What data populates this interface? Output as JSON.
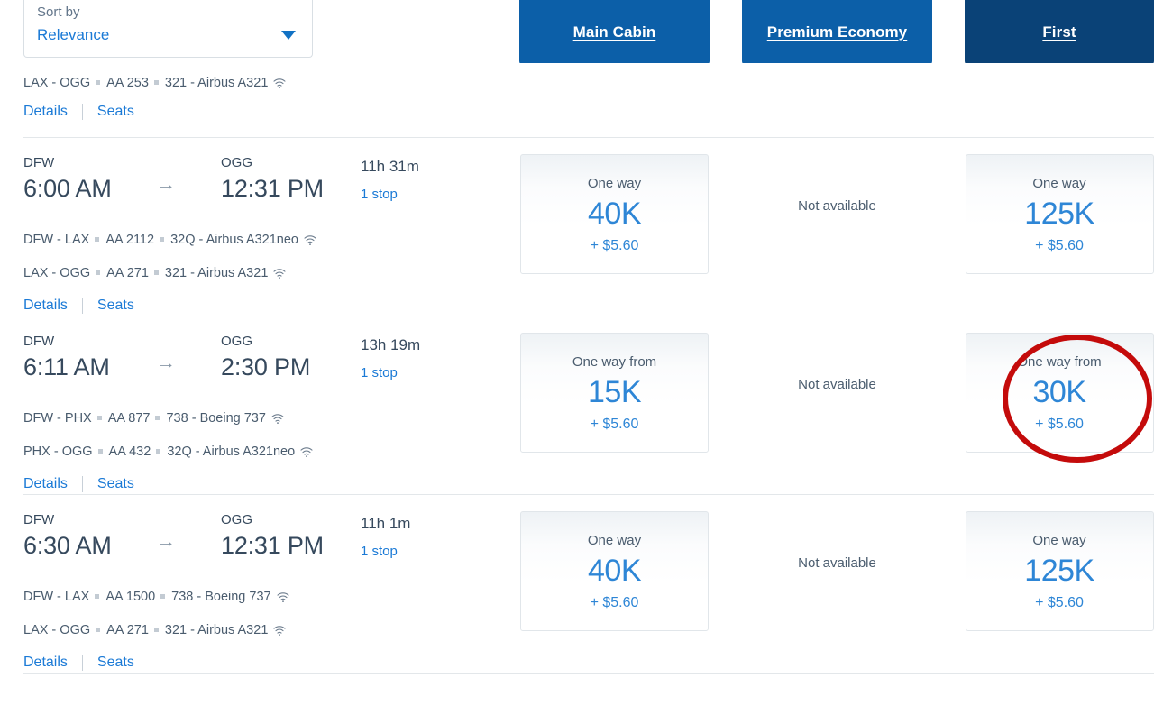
{
  "sort": {
    "label": "Sort by",
    "value": "Relevance",
    "caret_icon": "chevron-down-icon"
  },
  "cabin_tabs": [
    {
      "id": "main-cabin",
      "label": "Main Cabin",
      "selected": false,
      "color": "#0c5fa8"
    },
    {
      "id": "premium-economy",
      "label": "Premium Economy",
      "selected": false,
      "color": "#0c5fa8"
    },
    {
      "id": "first",
      "label": "First",
      "selected": true,
      "color": "#0a4277"
    }
  ],
  "colors": {
    "tab_active": "#0a4277",
    "tab_inactive": "#0c5fa8",
    "link_blue": "#1b7ad6",
    "price_blue": "#2e86d6",
    "text_dark": "#36495d",
    "annotation_red": "#c40b0b",
    "divider": "#e3e7ea"
  },
  "links": {
    "details": "Details",
    "seats": "Seats"
  },
  "labels": {
    "not_available": "Not available",
    "one_way": "One way",
    "one_way_from": "One way from",
    "wifi_icon": "wifi-icon",
    "arrow_icon": "arrow-right-icon"
  },
  "partial_row": {
    "leg": {
      "route": "LAX - OGG",
      "flight": "AA 253",
      "equipment": "321 - Airbus A321",
      "wifi": true
    }
  },
  "flights": [
    {
      "origin_code": "DFW",
      "depart_time": "6:00 AM",
      "dest_code": "OGG",
      "arrive_time": "12:31 PM",
      "duration": "11h 31m",
      "stops": "1 stop",
      "legs": [
        {
          "route": "DFW - LAX",
          "flight": "AA 2112",
          "equipment": "32Q - Airbus A321neo",
          "wifi": true
        },
        {
          "route": "LAX - OGG",
          "flight": "AA 271",
          "equipment": "321 - Airbus A321",
          "wifi": true
        }
      ],
      "fares": [
        {
          "cabin": "Main Cabin",
          "available": true,
          "head": "One way",
          "miles": "40K",
          "tax": "+ $5.60",
          "highlighted": false
        },
        {
          "cabin": "Premium Economy",
          "available": false,
          "head": "",
          "miles": "",
          "tax": "",
          "highlighted": false
        },
        {
          "cabin": "First",
          "available": true,
          "head": "One way",
          "miles": "125K",
          "tax": "+ $5.60",
          "highlighted": false
        }
      ]
    },
    {
      "origin_code": "DFW",
      "depart_time": "6:11 AM",
      "dest_code": "OGG",
      "arrive_time": "2:30 PM",
      "duration": "13h 19m",
      "stops": "1 stop",
      "legs": [
        {
          "route": "DFW - PHX",
          "flight": "AA 877",
          "equipment": "738 - Boeing 737",
          "wifi": true
        },
        {
          "route": "PHX - OGG",
          "flight": "AA 432",
          "equipment": "32Q - Airbus A321neo",
          "wifi": true
        }
      ],
      "fares": [
        {
          "cabin": "Main Cabin",
          "available": true,
          "head": "One way from",
          "miles": "15K",
          "tax": "+ $5.60",
          "highlighted": false
        },
        {
          "cabin": "Premium Economy",
          "available": false,
          "head": "",
          "miles": "",
          "tax": "",
          "highlighted": false
        },
        {
          "cabin": "First",
          "available": true,
          "head": "One way from",
          "miles": "30K",
          "tax": "+ $5.60",
          "highlighted": true
        }
      ]
    },
    {
      "origin_code": "DFW",
      "depart_time": "6:30 AM",
      "dest_code": "OGG",
      "arrive_time": "12:31 PM",
      "duration": "11h 1m",
      "stops": "1 stop",
      "legs": [
        {
          "route": "DFW - LAX",
          "flight": "AA 1500",
          "equipment": "738 - Boeing 737",
          "wifi": true
        },
        {
          "route": "LAX - OGG",
          "flight": "AA 271",
          "equipment": "321 - Airbus A321",
          "wifi": true
        }
      ],
      "fares": [
        {
          "cabin": "Main Cabin",
          "available": true,
          "head": "One way",
          "miles": "40K",
          "tax": "+ $5.60",
          "highlighted": false
        },
        {
          "cabin": "Premium Economy",
          "available": false,
          "head": "",
          "miles": "",
          "tax": "",
          "highlighted": false
        },
        {
          "cabin": "First",
          "available": true,
          "head": "One way",
          "miles": "125K",
          "tax": "+ $5.60",
          "highlighted": false
        }
      ]
    }
  ],
  "annotation": {
    "shape": "ellipse",
    "color": "#c40b0b",
    "target": "flights.1.fares.2",
    "stroke_width": 6
  }
}
